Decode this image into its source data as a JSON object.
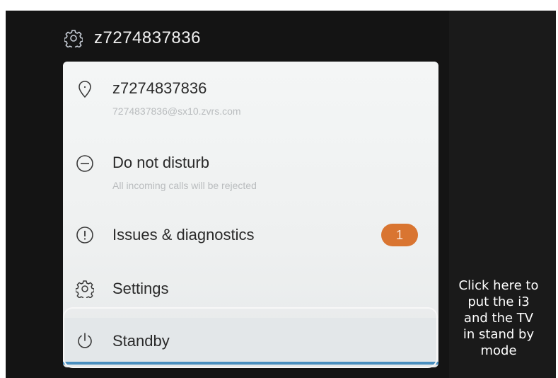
{
  "header": {
    "title": "z7274837836",
    "icon": "gear-icon"
  },
  "menu": {
    "items": [
      {
        "icon": "location-pin-icon",
        "label": "z7274837836",
        "sublabel": "7274837836@sx10.zvrs.com"
      },
      {
        "icon": "do-not-disturb-icon",
        "label": "Do not disturb",
        "sublabel": "All incoming calls will be rejected"
      },
      {
        "icon": "alert-icon",
        "label": "Issues & diagnostics",
        "badge": "1"
      },
      {
        "icon": "gear-icon",
        "label": "Settings"
      },
      {
        "icon": "power-icon",
        "label": "Standby",
        "selected": true
      }
    ]
  },
  "callout": {
    "lines": [
      "Click here to",
      "put the i3",
      "and the TV",
      "in stand by",
      "mode"
    ]
  },
  "colors": {
    "badge": "#d97531",
    "selection_underline": "#4a8fbf",
    "panel_background": "#f4f6f6",
    "screen_background": "#141414"
  }
}
